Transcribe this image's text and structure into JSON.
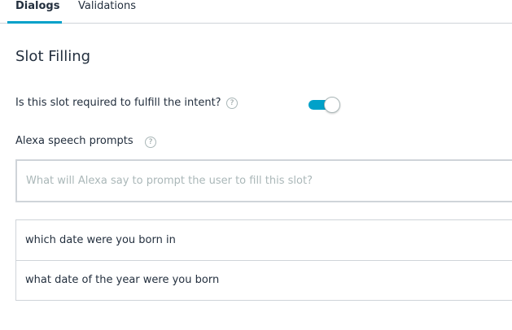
{
  "tabs": [
    {
      "label": "Dialogs",
      "active": true
    },
    {
      "label": "Validations",
      "active": false
    }
  ],
  "section_title": "Slot Filling",
  "required": {
    "label": "Is this slot required to fulfill the intent?",
    "help_icon": "question-circle-icon",
    "enabled": true
  },
  "prompts": {
    "label": "Alexa speech prompts",
    "help_icon": "question-circle-icon",
    "placeholder": "What will Alexa say to prompt the user to fill this slot?",
    "value": "",
    "items": [
      "which date were you born in",
      "what date of the year were you born"
    ]
  },
  "colors": {
    "accent": "#00a1c9",
    "border": "#cfd4d9",
    "text": "#232f3e",
    "placeholder": "#aab7b8"
  }
}
